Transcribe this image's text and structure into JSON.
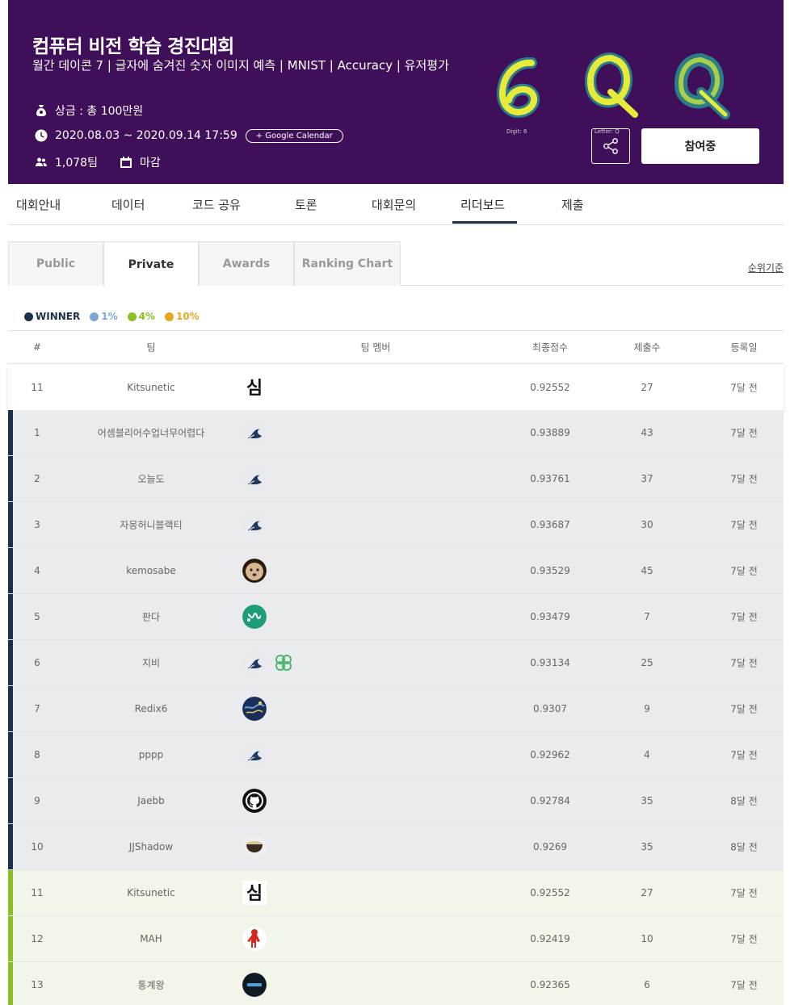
{
  "banner": {
    "title": "컴퓨터 비전 학습 경진대회",
    "subtitle": "월간 데이콘 7 | 글자에 숨겨진 숫자 이미지 예측 | MNIST | Accuracy | 유저평가",
    "prize": "상금 : 총 100만원",
    "dates": "2020.08.03 ~ 2020.09.14 17:59",
    "calendar_button": "+ Google Calendar",
    "teams": "1,078팀",
    "status": "마감",
    "digit_caption": "Digit: 6",
    "letter_caption": "Letter: Q",
    "join_button": "참여중",
    "bg_color": "#3f0f5a"
  },
  "nav": {
    "items": [
      "대회안내",
      "데이터",
      "코드 공유",
      "토론",
      "대회문의",
      "리더보드",
      "제출"
    ],
    "active": "리더보드"
  },
  "subtabs": {
    "items": [
      "Public",
      "Private",
      "Awards",
      "Ranking Chart"
    ],
    "active": "Private",
    "criteria": "순위기준"
  },
  "legend": [
    {
      "label": "WINNER",
      "color": "#1c3149"
    },
    {
      "label": "1%",
      "color": "#7aa7d0"
    },
    {
      "label": "4%",
      "color": "#8cbf26"
    },
    {
      "label": "10%",
      "color": "#e9a620"
    }
  ],
  "table": {
    "headers": {
      "rank": "#",
      "team": "팀",
      "members": "팀 멤버",
      "score": "최종점수",
      "subs": "제출수",
      "date": "등록일"
    },
    "my_row": {
      "rank": "11",
      "team": "Kitsunetic",
      "score": "0.92552",
      "subs": "27",
      "date": "7달 전",
      "avatars": [
        "sim-icon"
      ]
    },
    "rows": [
      {
        "rank": "1",
        "team": "어셈블리어수업너무어렵다",
        "score": "0.93889",
        "subs": "43",
        "date": "7달 전",
        "tier": "winner",
        "avatars": [
          "wave-icon"
        ]
      },
      {
        "rank": "2",
        "team": "오늘도",
        "score": "0.93761",
        "subs": "37",
        "date": "7달 전",
        "tier": "winner",
        "avatars": [
          "wave-icon"
        ]
      },
      {
        "rank": "3",
        "team": "자몽허니블랙티",
        "score": "0.93687",
        "subs": "30",
        "date": "7달 전",
        "tier": "winner",
        "avatars": [
          "wave-icon"
        ]
      },
      {
        "rank": "4",
        "team": "kemosabe",
        "score": "0.93529",
        "subs": "45",
        "date": "7달 전",
        "tier": "winner",
        "avatars": [
          "dog-icon"
        ]
      },
      {
        "rank": "5",
        "team": "판다",
        "score": "0.93479",
        "subs": "7",
        "date": "7달 전",
        "tier": "winner",
        "avatars": [
          "green-logo-icon"
        ]
      },
      {
        "rank": "6",
        "team": "지비",
        "score": "0.93134",
        "subs": "25",
        "date": "7달 전",
        "tier": "winner",
        "avatars": [
          "wave-icon",
          "clover-icon"
        ]
      },
      {
        "rank": "7",
        "team": "Redix6",
        "score": "0.9307",
        "subs": "9",
        "date": "7달 전",
        "tier": "winner",
        "avatars": [
          "night-sky-icon"
        ]
      },
      {
        "rank": "8",
        "team": "pppp",
        "score": "0.92962",
        "subs": "4",
        "date": "7달 전",
        "tier": "winner",
        "avatars": [
          "wave-icon"
        ]
      },
      {
        "rank": "9",
        "team": "Jaebb",
        "score": "0.92784",
        "subs": "35",
        "date": "8달 전",
        "tier": "winner",
        "avatars": [
          "github-icon"
        ]
      },
      {
        "rank": "10",
        "team": "JJShadow",
        "score": "0.9269",
        "subs": "35",
        "date": "8달 전",
        "tier": "winner",
        "avatars": [
          "bowl-icon"
        ]
      },
      {
        "rank": "11",
        "team": "Kitsunetic",
        "score": "0.92552",
        "subs": "27",
        "date": "7달 전",
        "tier": "pct4",
        "avatars": [
          "sim-icon"
        ]
      },
      {
        "rank": "12",
        "team": "MAH",
        "score": "0.92419",
        "subs": "10",
        "date": "7달 전",
        "tier": "pct4",
        "avatars": [
          "elmo-icon"
        ]
      },
      {
        "rank": "13",
        "team": "통계왕",
        "score": "0.92365",
        "subs": "6",
        "date": "7달 전",
        "tier": "pct4",
        "avatars": [
          "dark-badge-icon"
        ]
      }
    ]
  }
}
